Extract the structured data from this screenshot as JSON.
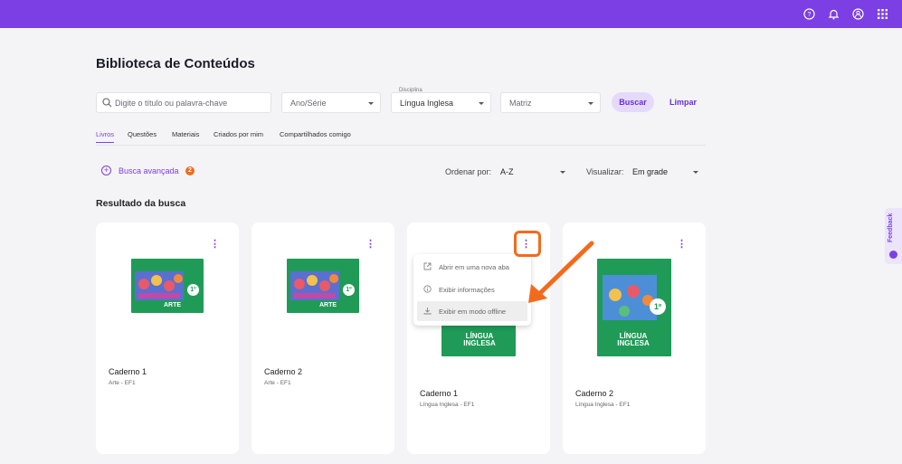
{
  "header": {
    "icons": [
      "help-icon",
      "bell-icon",
      "user-icon",
      "apps-grid-icon"
    ],
    "color": "#7b3fe4"
  },
  "page": {
    "title": "Biblioteca de Conteúdos"
  },
  "filters": {
    "search_placeholder": "Digite o título ou palavra-chave",
    "ano_serie": "Ano/Série",
    "disciplina_label": "Disciplina",
    "disciplina_value": "Língua Inglesa",
    "matriz": "Matriz",
    "buscar": "Buscar",
    "limpar": "Limpar"
  },
  "tabs": [
    "Livros",
    "Questões",
    "Materiais",
    "Criados por mim",
    "Compartilhados comigo"
  ],
  "advanced": {
    "label": "Busca avançada",
    "count": "2"
  },
  "sort": {
    "label": "Ordenar por:",
    "value": "A-Z"
  },
  "view": {
    "label": "Visualizar:",
    "value": "Em grade"
  },
  "results_title": "Resultado da busca",
  "cards": [
    {
      "title": "Caderno 1",
      "subtitle": "Arte - EF1",
      "cover_label": "ARTE",
      "grade": "1º"
    },
    {
      "title": "Caderno 2",
      "subtitle": "Arte - EF1",
      "cover_label": "ARTE",
      "grade": "1º"
    },
    {
      "title": "Caderno 1",
      "subtitle": "Língua Inglesa - EF1",
      "cover_label": "LÍNGUA INGLESA",
      "grade": "1º"
    },
    {
      "title": "Caderno 2",
      "subtitle": "Língua Inglesa - EF1",
      "cover_label": "LÍNGUA INGLESA",
      "grade": "1º"
    }
  ],
  "context_menu": {
    "items": [
      {
        "label": "Abrir em uma nova aba",
        "icon": "external-link-icon"
      },
      {
        "label": "Exibir informações",
        "icon": "info-icon"
      },
      {
        "label": "Exibir em modo offline",
        "icon": "download-icon"
      }
    ]
  },
  "feedback": {
    "label": "Feedback"
  },
  "accent": "#f26b1d"
}
